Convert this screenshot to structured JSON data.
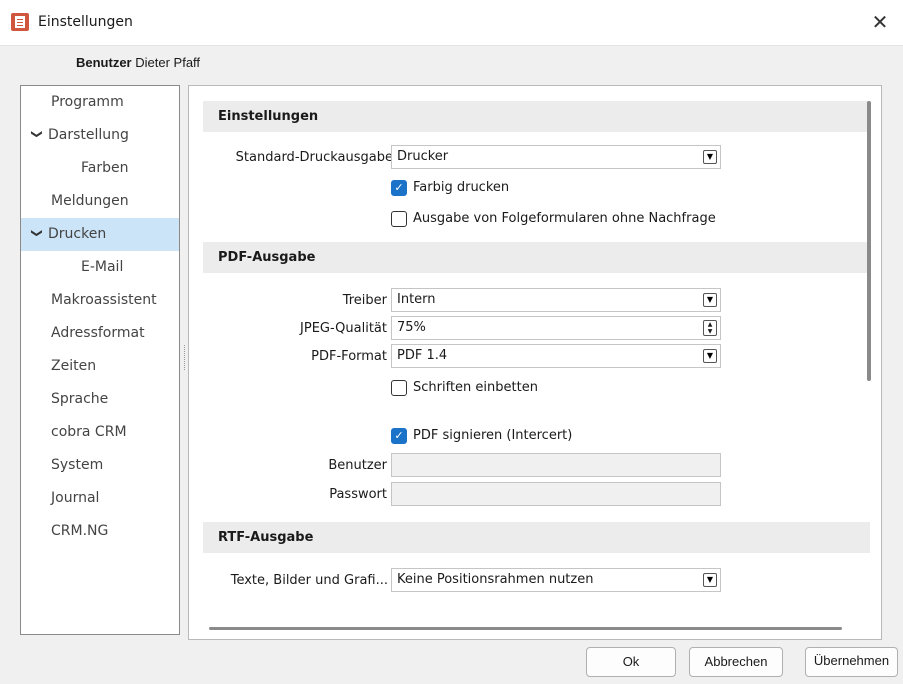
{
  "window": {
    "title": "Einstellungen",
    "close_glyph": "✕"
  },
  "user": {
    "label": "Benutzer",
    "name": "Dieter Pfaff"
  },
  "nav": {
    "items": [
      {
        "label": "Programm",
        "indent": 0,
        "expanded": false,
        "selected": false
      },
      {
        "label": "Darstellung",
        "indent": 0,
        "expanded": true,
        "selected": false
      },
      {
        "label": "Farben",
        "indent": 1,
        "expanded": false,
        "selected": false
      },
      {
        "label": "Meldungen",
        "indent": 0,
        "expanded": false,
        "selected": false
      },
      {
        "label": "Drucken",
        "indent": 0,
        "expanded": true,
        "selected": true
      },
      {
        "label": "E-Mail",
        "indent": 1,
        "expanded": false,
        "selected": false
      },
      {
        "label": "Makroassistent",
        "indent": 0,
        "expanded": false,
        "selected": false
      },
      {
        "label": "Adressformat",
        "indent": 0,
        "expanded": false,
        "selected": false
      },
      {
        "label": "Zeiten",
        "indent": 0,
        "expanded": false,
        "selected": false
      },
      {
        "label": "Sprache",
        "indent": 0,
        "expanded": false,
        "selected": false
      },
      {
        "label": "cobra CRM",
        "indent": 0,
        "expanded": false,
        "selected": false
      },
      {
        "label": "System",
        "indent": 0,
        "expanded": false,
        "selected": false
      },
      {
        "label": "Journal",
        "indent": 0,
        "expanded": false,
        "selected": false
      },
      {
        "label": "CRM.NG",
        "indent": 0,
        "expanded": false,
        "selected": false
      }
    ]
  },
  "einstellungen": {
    "header": "Einstellungen",
    "standard_druckausgabe": {
      "label": "Standard-Druckausgabe",
      "value": "Drucker"
    },
    "farbig_drucken": {
      "label": "Farbig drucken",
      "checked": true
    },
    "folgeformulare": {
      "label": "Ausgabe von Folgeformularen ohne Nachfrage",
      "checked": false
    }
  },
  "pdf": {
    "header": "PDF-Ausgabe",
    "treiber": {
      "label": "Treiber",
      "value": "Intern"
    },
    "jpeg": {
      "label": "JPEG-Qualität",
      "value": "75%"
    },
    "format": {
      "label": "PDF-Format",
      "value": "PDF 1.4"
    },
    "schriften": {
      "label": "Schriften einbetten",
      "checked": false
    },
    "signieren": {
      "label": "PDF signieren (Intercert)",
      "checked": true
    },
    "benutzer": {
      "label": "Benutzer",
      "value": ""
    },
    "passwort": {
      "label": "Passwort",
      "value": ""
    }
  },
  "rtf": {
    "header": "RTF-Ausgabe",
    "texte": {
      "label": "Texte, Bilder und Grafi...",
      "value": "Keine Positionsrahmen nutzen"
    }
  },
  "buttons": {
    "ok": "Ok",
    "abbrechen": "Abbrechen",
    "uebernehmen": "Übernehmen"
  },
  "icons": {
    "app": "settings-document-icon",
    "close": "close-icon",
    "expand": "chevron-down-icon",
    "dropdown": "dropdown-arrow-icon",
    "check": "checkmark-icon",
    "spin": "spin-updown-icon"
  },
  "colors": {
    "accent": "#1a73c9",
    "selection": "#cce4f7",
    "section_bg": "#ececec"
  }
}
